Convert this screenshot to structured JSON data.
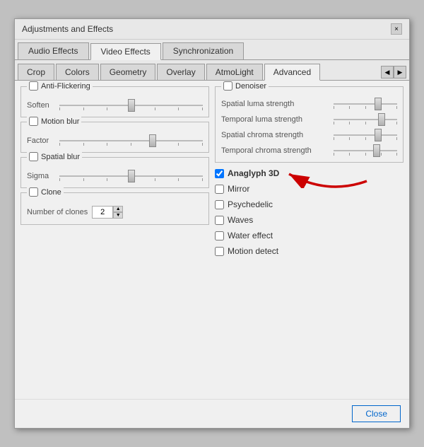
{
  "dialog": {
    "title": "Adjustments and Effects",
    "close_btn_label": "×"
  },
  "main_tabs": [
    {
      "label": "Audio Effects",
      "active": false
    },
    {
      "label": "Video Effects",
      "active": true
    },
    {
      "label": "Synchronization",
      "active": false
    }
  ],
  "sub_tabs": [
    {
      "label": "Crop",
      "active": false
    },
    {
      "label": "Colors",
      "active": false
    },
    {
      "label": "Geometry",
      "active": false
    },
    {
      "label": "Overlay",
      "active": false
    },
    {
      "label": "AtmoLight",
      "active": false
    },
    {
      "label": "Advanced",
      "active": true
    }
  ],
  "left": {
    "anti_flickering": {
      "label": "Anti-Flickering",
      "checked": false,
      "soften_label": "Soften"
    },
    "motion_blur": {
      "label": "Motion blur",
      "checked": false,
      "factor_label": "Factor"
    },
    "spatial_blur": {
      "label": "Spatial blur",
      "checked": false,
      "sigma_label": "Sigma"
    },
    "clone": {
      "label": "Clone",
      "checked": false,
      "num_clones_label": "Number of clones",
      "num_clones_value": "2"
    }
  },
  "right": {
    "denoiser": {
      "label": "Denoiser",
      "checked": false,
      "rows": [
        {
          "label": "Spatial luma strength"
        },
        {
          "label": "Temporal luma strength"
        },
        {
          "label": "Spatial chroma strength"
        },
        {
          "label": "Temporal chroma strength"
        }
      ]
    },
    "effects": [
      {
        "label": "Anaglyph 3D",
        "checked": true,
        "has_arrow": true
      },
      {
        "label": "Mirror",
        "checked": false
      },
      {
        "label": "Psychedelic",
        "checked": false
      },
      {
        "label": "Waves",
        "checked": false
      },
      {
        "label": "Water effect",
        "checked": false
      },
      {
        "label": "Motion detect",
        "checked": false
      }
    ]
  },
  "footer": {
    "close_label": "Close"
  }
}
